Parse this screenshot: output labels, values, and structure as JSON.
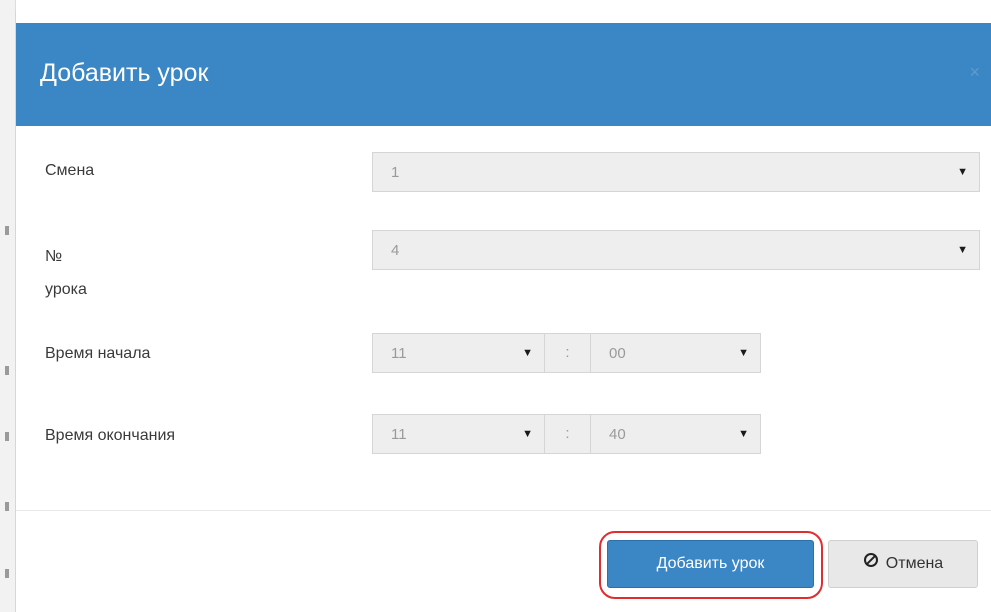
{
  "dialog": {
    "title": "Добавить урок",
    "close_glyph": "×"
  },
  "form": {
    "shift": {
      "label": "Смена",
      "value": "1"
    },
    "lesson_number": {
      "label_line1": "№",
      "label_line2": "урока",
      "value": "4"
    },
    "start_time": {
      "label": "Время начала",
      "hour": "11",
      "separator": ":",
      "minute": "00"
    },
    "end_time": {
      "label": "Время окончания",
      "hour": "11",
      "separator": ":",
      "minute": "40"
    }
  },
  "footer": {
    "add_label": "Добавить урок",
    "cancel_label": "Отмена"
  },
  "icons": {
    "dropdown": "chevron-down-icon",
    "cancel": "ban-icon"
  },
  "colors": {
    "header": "#3b86c4",
    "highlight_ring": "#e02d2d",
    "field_bg": "#eeeeee"
  }
}
